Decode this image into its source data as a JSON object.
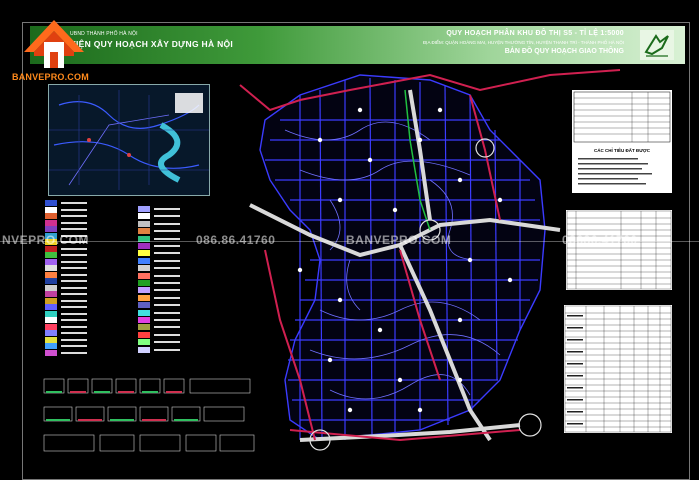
{
  "brand": {
    "site": "BANVEPRO.COM",
    "colors": {
      "roof_top": "#ff6a1c",
      "roof_bottom": "#e04010",
      "house": "#ffffff"
    }
  },
  "header": {
    "org_line_1": "UBND THÀNH PHỐ HÀ NỘI",
    "org_line_2": "VIỆN QUY HOẠCH XÂY DỰNG HÀ NỘI",
    "plan_title": "QUY HOẠCH PHÂN KHU ĐÔ THỊ S5 - TỈ LỆ 1:5000",
    "location": "ĐỊA ĐIỂM: QUẬN HOÀNG MAI, HUYỆN THƯỜNG TÍN, HUYỆN THANH TRÌ - THÀNH PHỐ HÀ NỘI",
    "sheet_title": "BẢN ĐỒ QUY HOẠCH GIAO THÔNG",
    "band_color_start": "#1c6a1c",
    "band_color_end": "#d9f1d5"
  },
  "watermark": {
    "left_site": "NVEPRO.COM",
    "phone": "086.86.41760",
    "center_site": "BANVEPRO.COM",
    "right_phone": "08686.41760"
  },
  "panel": {
    "info_title": "CÁC CHỈ TIÊU ĐẤT ĐƯỢC"
  },
  "colors": {
    "background": "#000000",
    "road_main": "#3b3bff",
    "road_secondary": "#6f6fff",
    "road_arterial": "#d9d9d9",
    "road_red": "#d02050",
    "road_green": "#20c040",
    "node": "#ffffff"
  },
  "legend_swatches_left": [
    "#3050d0",
    "#ffffff",
    "#e06030",
    "#d03090",
    "#8040c0",
    "#30a0d0",
    "#f0d020",
    "#c02020",
    "#40c040",
    "#a060f0",
    "#e0e0e0",
    "#ff8040",
    "#2040a0",
    "#d0d0d0",
    "#c040a0",
    "#d0a020",
    "#6060ff",
    "#30d0c0",
    "#ffffff",
    "#ff4060",
    "#8080ff",
    "#e0e040",
    "#40a0ff",
    "#d050d0"
  ],
  "legend_swatches_right": [
    "#a0a0ff",
    "#ffffff",
    "#c0c0c0",
    "#e08040",
    "#30c080",
    "#a030c0",
    "#ffff40",
    "#4080ff",
    "#d0d0d0",
    "#ff7060",
    "#20a020",
    "#c0a0ff",
    "#ffa040",
    "#6060c0",
    "#40e0e0",
    "#e040e0",
    "#a0a040",
    "#ff4040",
    "#80ff80",
    "#d0d0ff"
  ]
}
